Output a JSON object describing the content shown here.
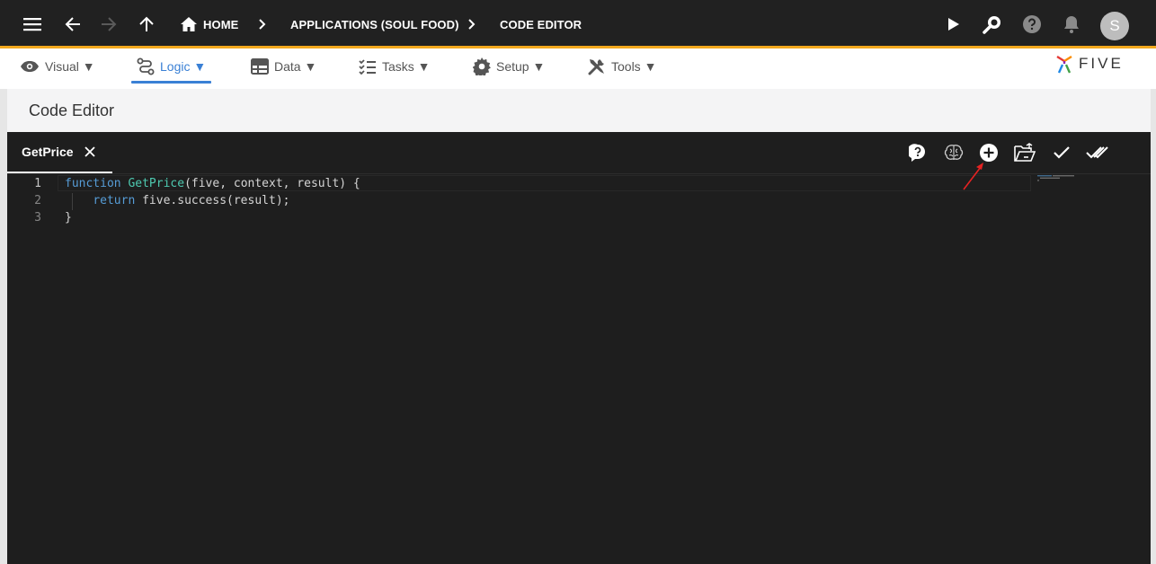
{
  "topbar": {
    "breadcrumbs": [
      {
        "label": "HOME"
      },
      {
        "label": "APPLICATIONS (SOUL FOOD)"
      },
      {
        "label": "CODE EDITOR"
      }
    ],
    "avatar_initial": "S"
  },
  "menu": {
    "items": [
      {
        "label": "Visual ▼",
        "icon": "eye-icon"
      },
      {
        "label": "Logic ▼",
        "icon": "route-icon",
        "active": true
      },
      {
        "label": "Data ▼",
        "icon": "table-icon"
      },
      {
        "label": "Tasks ▼",
        "icon": "checklist-icon"
      },
      {
        "label": "Setup ▼",
        "icon": "gear-icon"
      },
      {
        "label": "Tools ▼",
        "icon": "tools-icon"
      }
    ]
  },
  "logo": {
    "text": "FIVE"
  },
  "page": {
    "title": "Code Editor"
  },
  "editor": {
    "tab_label": "GetPrice",
    "toolbar_icons": [
      "help-bubble-icon",
      "brain-icon",
      "add-circle-icon",
      "open-folder-icon",
      "check-icon",
      "double-check-icon"
    ],
    "lines": [
      {
        "number": "1",
        "code": "function GetPrice(five, context, result) {"
      },
      {
        "number": "2",
        "code": "    return five.success(result);"
      },
      {
        "number": "3",
        "code": "}"
      }
    ],
    "tokens": {
      "l1_kw": "function",
      "l1_fn": "GetPrice",
      "l1_rest": "(five, context, result) {",
      "l2_indent": "    ",
      "l2_kw": "return",
      "l2_rest": " five.success(result);",
      "l3": "}"
    }
  },
  "colors": {
    "topbar": "#212121",
    "accent_orange": "#f2a81d",
    "active_blue": "#3a80d5",
    "editor_bg": "#1e1e1e",
    "keyword": "#569cd6",
    "function_name": "#4ec9b0",
    "annotation_arrow": "#e52222"
  }
}
